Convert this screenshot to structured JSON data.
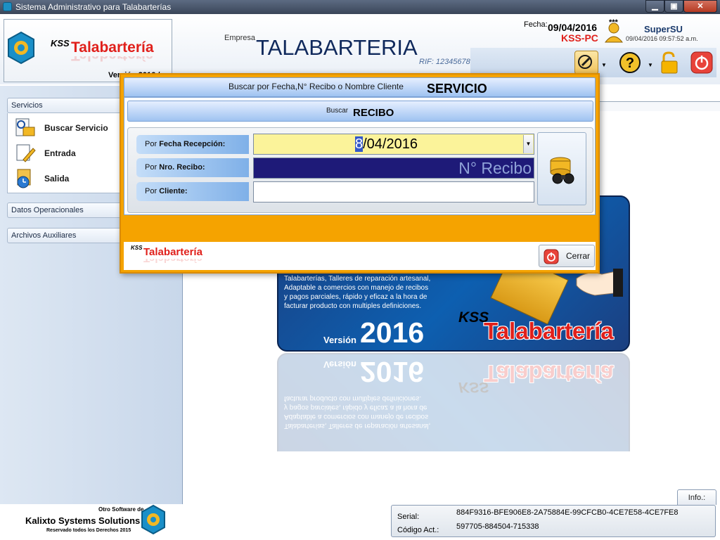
{
  "window": {
    "title": "Sistema Administrativo para Talabarterías",
    "minimize_glyph": "▁",
    "maximize_glyph": "▣",
    "close_glyph": "✕"
  },
  "header": {
    "logo_kss": "KSS",
    "logo_name": "Talabartería",
    "logo_version": "Versión 2016 /",
    "empresa_label": "Empresa",
    "empresa_name": "TALABARTERIA",
    "rif": "RIF: 12345678",
    "fecha_label": "Fecha:",
    "fecha_value": "09/04/2016",
    "pc_name": "KSS-PC",
    "user_stars": "***",
    "user_name": "SuperSU",
    "user_datetime": "09/04/2016  09:57:52 a.m.",
    "dropdown_glyph": "▼"
  },
  "sidebar": {
    "sections": [
      {
        "label": "Servicios"
      },
      {
        "label": "Datos Operacionales"
      },
      {
        "label": "Archivos Auxiliares"
      }
    ],
    "items": [
      {
        "label": "Buscar Servicio",
        "icon": "search-document-icon"
      },
      {
        "label": "Entrada",
        "icon": "edit-document-icon"
      },
      {
        "label": "Salida",
        "icon": "folder-clock-icon"
      }
    ],
    "footer": {
      "other_software": "Otro Software de",
      "company": "Kalixto Systems Solutions",
      "rights": "Reservado todos los Derechos 2015"
    }
  },
  "splash": {
    "description": "Talabarterías, Talleres de reparación artesanal, Adaptable a comercios con manejo de recibos y pagos parciales, rápido y eficaz a la hora de facturar producto con multiples definiciones.",
    "version_label": "Versión",
    "version": "2016",
    "kss": "KSS",
    "name": "Talabartería"
  },
  "status": {
    "info_tab": "Info.:",
    "serial_label": "Serial:",
    "serial_value": "884F9316-BFE906E8-2A75884E-99CFCB0-4CE7E58-4CE7FE8",
    "code_label": "Código Act.:",
    "code_value": "597705-884504-715338"
  },
  "dialog": {
    "header_small": "Buscar por Fecha,N° Recibo o Nombre Cliente",
    "header_big": "SERVICIO",
    "sub_small": "Buscar",
    "sub_big": "RECIBO",
    "fields": {
      "fecha": {
        "label_prefix": "Por ",
        "label_bold": "Fecha Recepción:",
        "value_caret": "8",
        "value_rest": "/04/2016"
      },
      "nro": {
        "label_prefix": "Por ",
        "label_bold": "Nro. Recibo:",
        "placeholder": "N° Recibo"
      },
      "cliente": {
        "label_prefix": "Por ",
        "label_bold": "Cliente:",
        "value": ""
      }
    },
    "footer_kss": "KSS",
    "footer_name": "Talabartería",
    "close_label": "Cerrar"
  },
  "colors": {
    "accent_orange": "#f5a300",
    "brand_red": "#e0201b",
    "nro_field_bg": "#1e1a78",
    "date_field_bg": "#fbf39a"
  }
}
